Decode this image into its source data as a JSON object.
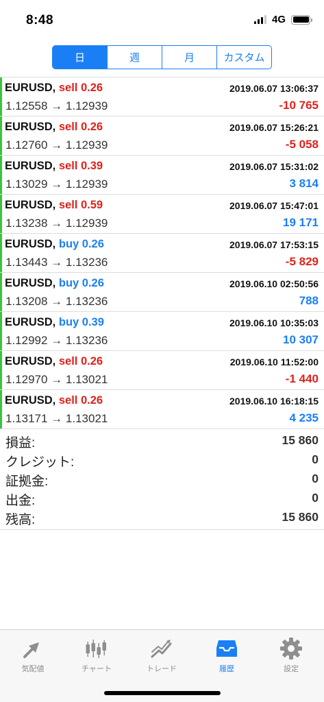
{
  "status_bar": {
    "time": "8:48",
    "network": "4G"
  },
  "period_tabs": [
    {
      "label": "日",
      "active": true
    },
    {
      "label": "週",
      "active": false
    },
    {
      "label": "月",
      "active": false
    },
    {
      "label": "カスタム",
      "active": false
    }
  ],
  "trades": [
    {
      "symbol": "EURUSD,",
      "side": "sell",
      "volume": "0.26",
      "time": "2019.06.07 13:06:37",
      "prices": "1.12558 → 1.12939",
      "profit": "-10 765",
      "profit_sign": "neg"
    },
    {
      "symbol": "EURUSD,",
      "side": "sell",
      "volume": "0.26",
      "time": "2019.06.07 15:26:21",
      "prices": "1.12760 → 1.12939",
      "profit": "-5 058",
      "profit_sign": "neg"
    },
    {
      "symbol": "EURUSD,",
      "side": "sell",
      "volume": "0.39",
      "time": "2019.06.07 15:31:02",
      "prices": "1.13029 → 1.12939",
      "profit": "3 814",
      "profit_sign": "pos"
    },
    {
      "symbol": "EURUSD,",
      "side": "sell",
      "volume": "0.59",
      "time": "2019.06.07 15:47:01",
      "prices": "1.13238 → 1.12939",
      "profit": "19 171",
      "profit_sign": "pos"
    },
    {
      "symbol": "EURUSD,",
      "side": "buy",
      "volume": "0.26",
      "time": "2019.06.07 17:53:15",
      "prices": "1.13443 → 1.13236",
      "profit": "-5 829",
      "profit_sign": "neg"
    },
    {
      "symbol": "EURUSD,",
      "side": "buy",
      "volume": "0.26",
      "time": "2019.06.10 02:50:56",
      "prices": "1.13208 → 1.13236",
      "profit": "788",
      "profit_sign": "pos"
    },
    {
      "symbol": "EURUSD,",
      "side": "buy",
      "volume": "0.39",
      "time": "2019.06.10 10:35:03",
      "prices": "1.12992 → 1.13236",
      "profit": "10 307",
      "profit_sign": "pos"
    },
    {
      "symbol": "EURUSD,",
      "side": "sell",
      "volume": "0.26",
      "time": "2019.06.10 11:52:00",
      "prices": "1.12970 → 1.13021",
      "profit": "-1 440",
      "profit_sign": "neg"
    },
    {
      "symbol": "EURUSD,",
      "side": "sell",
      "volume": "0.26",
      "time": "2019.06.10 16:18:15",
      "prices": "1.13171 → 1.13021",
      "profit": "4 235",
      "profit_sign": "pos"
    }
  ],
  "summary": [
    {
      "label": "損益:",
      "value": "15 860"
    },
    {
      "label": "クレジット:",
      "value": "0"
    },
    {
      "label": "証拠金:",
      "value": "0"
    },
    {
      "label": "出金:",
      "value": "0"
    },
    {
      "label": "残高:",
      "value": "15 860"
    }
  ],
  "tab_bar": [
    {
      "label": "気配値",
      "icon": "quotes-icon",
      "active": false
    },
    {
      "label": "チャート",
      "icon": "candlestick-chart-icon",
      "active": false
    },
    {
      "label": "トレード",
      "icon": "trade-icon",
      "active": false
    },
    {
      "label": "履歴",
      "icon": "history-inbox-icon",
      "active": true
    },
    {
      "label": "設定",
      "icon": "gear-icon",
      "active": false
    }
  ],
  "colors": {
    "accent": "#1a7ff5",
    "sell": "#e0211b",
    "buy": "#1a7ff5",
    "row_marker": "#3cc43c",
    "inactive_tab": "#8e8e8e"
  }
}
